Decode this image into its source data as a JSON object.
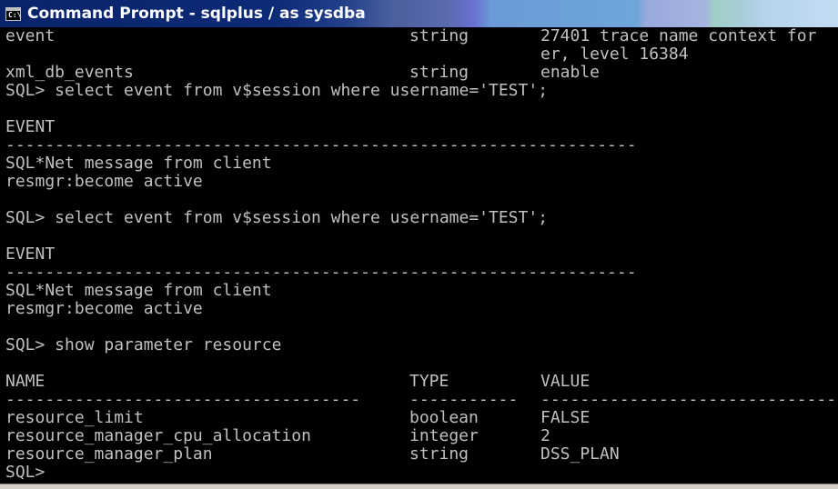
{
  "window": {
    "title": "Command Prompt - sqlplus / as sysdba",
    "icon_label": "C:\\"
  },
  "console": {
    "lines": [
      {
        "c1": "event",
        "c2": "string",
        "c3": "27401 trace name context for"
      },
      {
        "c1": "",
        "c2": "",
        "c3": "er, level 16384"
      },
      {
        "c1": "xml_db_events",
        "c2": "string",
        "c3": "enable"
      },
      {
        "c1": "SQL> select event from v$session where username='TEST';",
        "c2": "",
        "c3": ""
      },
      {
        "c1": "",
        "c2": "",
        "c3": ""
      },
      {
        "c1": "EVENT",
        "c2": "",
        "c3": ""
      },
      {
        "c1": "----------------------------------------------------------------",
        "c2": "",
        "c3": ""
      },
      {
        "c1": "SQL*Net message from client",
        "c2": "",
        "c3": ""
      },
      {
        "c1": "resmgr:become active",
        "c2": "",
        "c3": ""
      },
      {
        "c1": "",
        "c2": "",
        "c3": ""
      },
      {
        "c1": "SQL> select event from v$session where username='TEST';",
        "c2": "",
        "c3": ""
      },
      {
        "c1": "",
        "c2": "",
        "c3": ""
      },
      {
        "c1": "EVENT",
        "c2": "",
        "c3": ""
      },
      {
        "c1": "----------------------------------------------------------------",
        "c2": "",
        "c3": ""
      },
      {
        "c1": "SQL*Net message from client",
        "c2": "",
        "c3": ""
      },
      {
        "c1": "resmgr:become active",
        "c2": "",
        "c3": ""
      },
      {
        "c1": "",
        "c2": "",
        "c3": ""
      },
      {
        "c1": "SQL> show parameter resource",
        "c2": "",
        "c3": ""
      },
      {
        "c1": "",
        "c2": "",
        "c3": ""
      },
      {
        "c1": "NAME",
        "c2": "TYPE",
        "c3": "VALUE"
      },
      {
        "c1": "------------------------------------",
        "c2": "-----------",
        "c3": "------------------------------"
      },
      {
        "c1": "resource_limit",
        "c2": "boolean",
        "c3": "FALSE"
      },
      {
        "c1": "resource_manager_cpu_allocation",
        "c2": "integer",
        "c3": "2"
      },
      {
        "c1": "resource_manager_plan",
        "c2": "string",
        "c3": "DSS_PLAN"
      },
      {
        "c1": "SQL>",
        "c2": "",
        "c3": ""
      }
    ]
  }
}
